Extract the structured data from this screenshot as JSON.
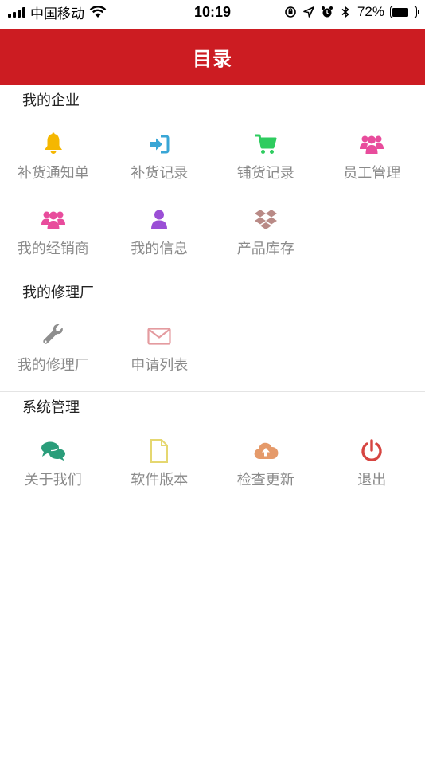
{
  "status_bar": {
    "carrier": "中国移动",
    "time": "10:19",
    "battery": "72%",
    "battery_level": 0.72
  },
  "header": {
    "title": "目录",
    "background": "#cc1c22"
  },
  "sections": [
    {
      "title": "我的企业",
      "items": [
        {
          "label": "补货通知单",
          "icon": "bell-icon",
          "color": "#f5b700"
        },
        {
          "label": "补货记录",
          "icon": "sign-in-icon",
          "color": "#39a6d6"
        },
        {
          "label": "铺货记录",
          "icon": "cart-icon",
          "color": "#2ecc5f"
        },
        {
          "label": "员工管理",
          "icon": "users-icon",
          "color": "#e84c9c"
        },
        {
          "label": "我的经销商",
          "icon": "users-icon",
          "color": "#e84c9c"
        },
        {
          "label": "我的信息",
          "icon": "user-icon",
          "color": "#9b4fd6"
        },
        {
          "label": "产品库存",
          "icon": "dropbox-icon",
          "color": "#b98a86"
        }
      ]
    },
    {
      "title": "我的修理厂",
      "items": [
        {
          "label": "我的修理厂",
          "icon": "wrench-icon",
          "color": "#8e8e8e"
        },
        {
          "label": "申请列表",
          "icon": "envelope-icon",
          "color": "#e49b9f"
        }
      ]
    },
    {
      "title": "系统管理",
      "items": [
        {
          "label": "关于我们",
          "icon": "chat-icon",
          "color": "#2a9d7a"
        },
        {
          "label": "软件版本",
          "icon": "file-icon",
          "color": "#e5d770"
        },
        {
          "label": "检查更新",
          "icon": "cloud-upload-icon",
          "color": "#e59a6a"
        },
        {
          "label": "退出",
          "icon": "power-icon",
          "color": "#d64541"
        }
      ]
    }
  ]
}
